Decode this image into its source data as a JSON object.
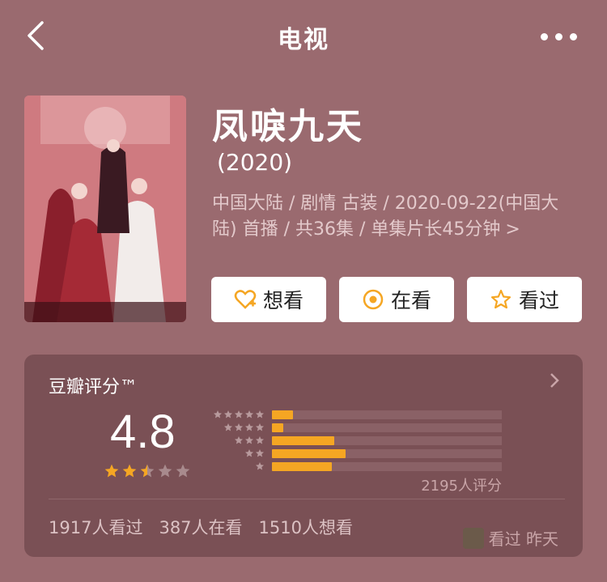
{
  "header": {
    "title": "电视"
  },
  "movie": {
    "title": "凤唳九天",
    "year": "(2020)",
    "meta": "中国大陆 / 剧情 古装 / 2020-09-22(中国大陆) 首播 / 共36集 / 单集片长45分钟",
    "meta_arrow": ">"
  },
  "actions": {
    "want": "想看",
    "watching": "在看",
    "watched": "看过"
  },
  "rating": {
    "label": "豆瓣评分™",
    "score": "4.8",
    "stars_filled": 2.5,
    "distribution_percent": [
      9,
      5,
      27,
      32,
      26
    ],
    "count_text": "2195人评分",
    "stats": {
      "watched": "1917人看过",
      "watching": "387人在看",
      "want": "1510人想看"
    },
    "watermark": "看过 昨天"
  },
  "colors": {
    "background": "#9a6a6f",
    "card": "#7a5055",
    "accent": "#f5a623"
  }
}
